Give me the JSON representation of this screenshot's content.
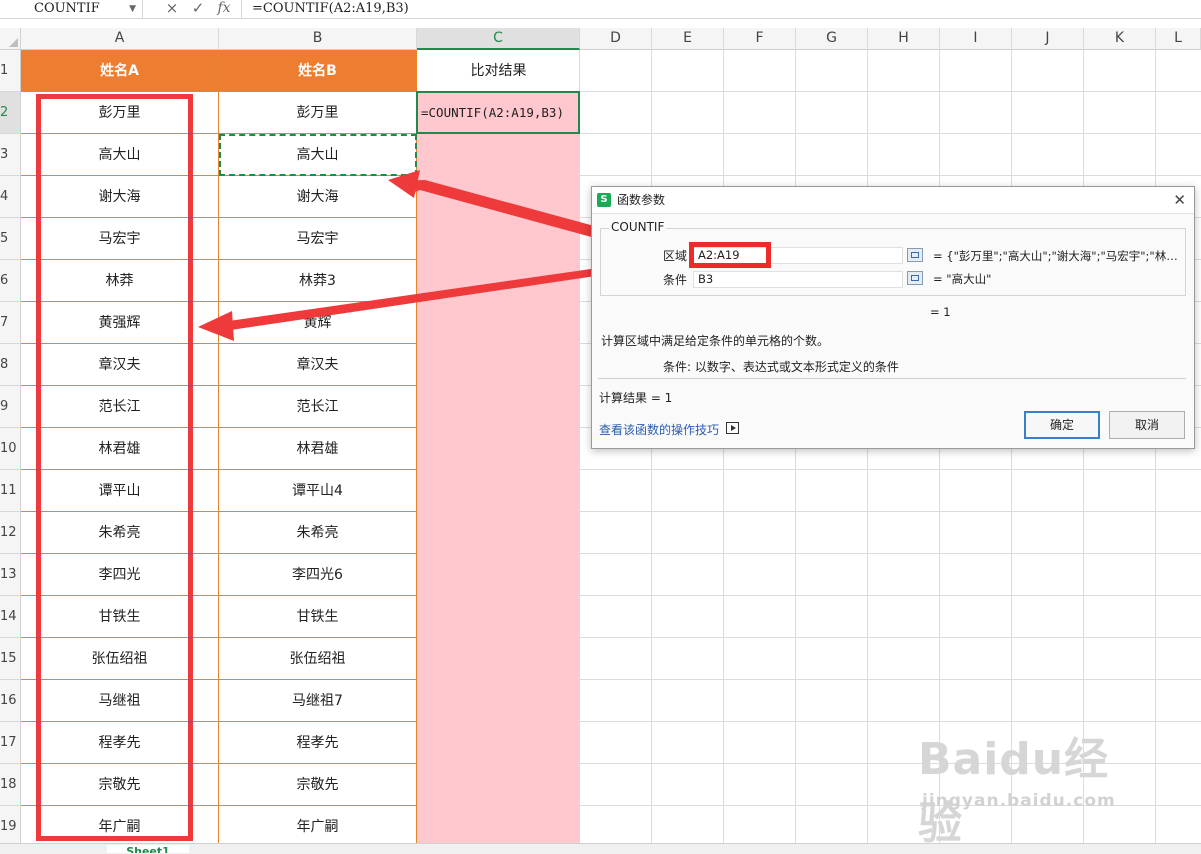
{
  "formula_bar": {
    "name_box": "COUNTIF",
    "cancel_icon": "×",
    "confirm_icon": "✓",
    "fx_label": "fx",
    "formula": "=COUNTIF(A2:A19,B3)"
  },
  "columns": [
    "A",
    "B",
    "C",
    "D",
    "E",
    "F",
    "G",
    "H",
    "I",
    "J",
    "K",
    "L"
  ],
  "rows": [
    "1",
    "2",
    "3",
    "4",
    "5",
    "6",
    "7",
    "8",
    "9",
    "10",
    "11",
    "12",
    "13",
    "14",
    "15",
    "16",
    "17",
    "18",
    "19"
  ],
  "header_row": {
    "a": "姓名A",
    "b": "姓名B",
    "c": "比对结果"
  },
  "col_a": [
    "彭万里",
    "高大山",
    "谢大海",
    "马宏宇",
    "林莽",
    "黄强辉",
    "章汉夫",
    "范长江",
    "林君雄",
    "谭平山",
    "朱希亮",
    "李四光",
    "甘铁生",
    "张伍绍祖",
    "马继祖",
    "程孝先",
    "宗敬先",
    "年广嗣"
  ],
  "col_b": [
    "彭万里",
    "高大山",
    "谢大海",
    "马宏宇",
    "林莽3",
    "黄辉",
    "章汉夫",
    "范长江",
    "林君雄",
    "谭平山4",
    "朱希亮",
    "李四光6",
    "甘铁生",
    "张伍绍祖",
    "马继祖7",
    "程孝先",
    "宗敬先",
    "年广嗣"
  ],
  "active_cell_text": "=COUNTIF(A2:A19,B3)",
  "sheet_tab": "Sheet1",
  "dialog": {
    "title": "函数参数",
    "logo": "S",
    "close": "✕",
    "function_name": "COUNTIF",
    "range_label": "区域",
    "range_value": "A2:A19",
    "range_result": "= {\"彭万里\";\"高大山\";\"谢大海\";\"马宏宇\";\"林…",
    "criteria_label": "条件",
    "criteria_value": "B3",
    "criteria_result": "= \"高大山\"",
    "eq_result": "= 1",
    "description": "计算区域中满足给定条件的单元格的个数。",
    "param_desc": "条件:   以数字、表达式或文本形式定义的条件",
    "calc_result": "计算结果  =  1",
    "help_link": "查看该函数的操作技巧",
    "ok": "确定",
    "cancel": "取消"
  },
  "watermark": {
    "main": "Baidu经验",
    "sub": "jingyan.baidu.com"
  },
  "colors": {
    "header_orange": "#ed7d31",
    "highlight_pink": "#ffc7ce",
    "annotation_red": "#ee3a3a",
    "select_green": "#1f8a4c"
  }
}
